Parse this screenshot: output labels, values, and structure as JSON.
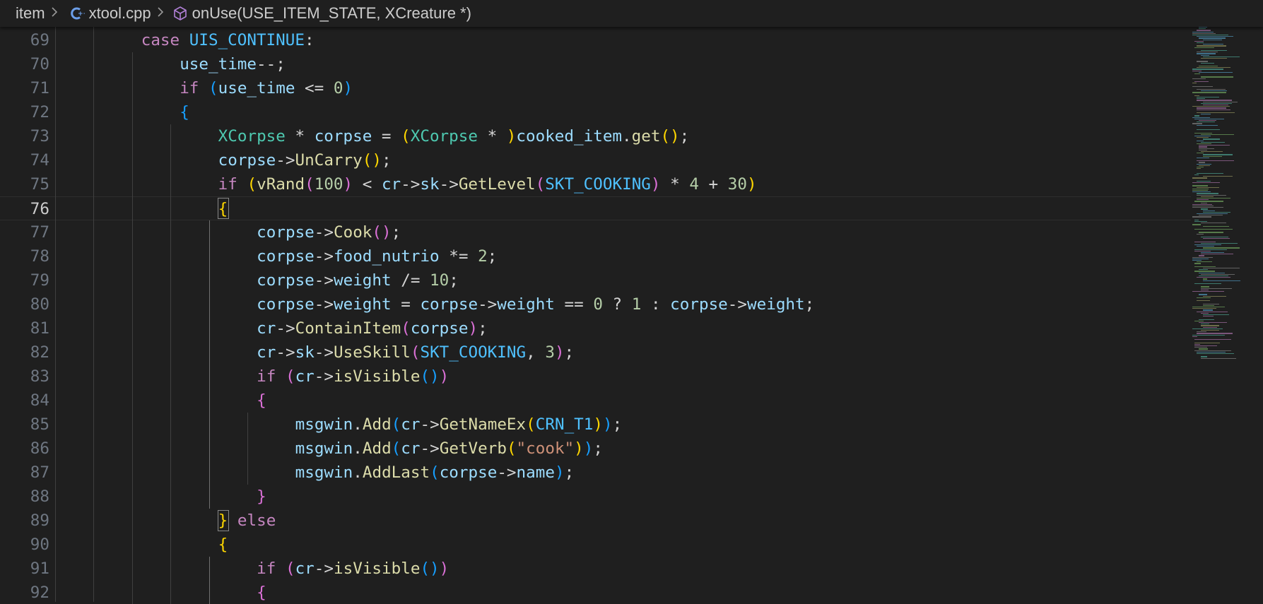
{
  "breadcrumb": {
    "folder": "item",
    "file": "xtool.cpp",
    "symbol": "onUse(USE_ITEM_STATE, XCreature *)",
    "file_icon": "cpp-file-icon",
    "symbol_icon": "method-cube-icon"
  },
  "editor": {
    "current_line": 76,
    "lines": [
      {
        "n": "69",
        "tokens": [
          [
            "case ",
            "kw"
          ],
          [
            "UIS_CONTINUE",
            "en"
          ],
          [
            ":",
            "op"
          ]
        ]
      },
      {
        "n": "70",
        "tokens": [
          [
            "use_time",
            "var"
          ],
          [
            "--;",
            "op"
          ]
        ]
      },
      {
        "n": "71",
        "tokens": [
          [
            "if ",
            "ctl"
          ],
          [
            "(",
            "b3"
          ],
          [
            "use_time",
            "var"
          ],
          [
            " <= ",
            "op"
          ],
          [
            "0",
            "num"
          ],
          [
            ")",
            "b3"
          ]
        ]
      },
      {
        "n": "72",
        "tokens": [
          [
            "{",
            "b3"
          ]
        ]
      },
      {
        "n": "73",
        "tokens": [
          [
            "XCorpse",
            "typ"
          ],
          [
            " * ",
            "op"
          ],
          [
            "corpse",
            "var"
          ],
          [
            " = ",
            "op"
          ],
          [
            "(",
            "b1"
          ],
          [
            "XCorpse",
            "typ"
          ],
          [
            " * ",
            "op"
          ],
          [
            ")",
            "b1"
          ],
          [
            "cooked_item",
            "var"
          ],
          [
            ".",
            "op"
          ],
          [
            "get",
            "fn"
          ],
          [
            "()",
            "b1"
          ],
          [
            ";",
            "op"
          ]
        ]
      },
      {
        "n": "74",
        "tokens": [
          [
            "corpse",
            "var"
          ],
          [
            "->",
            "op"
          ],
          [
            "UnCarry",
            "fn"
          ],
          [
            "()",
            "b1"
          ],
          [
            ";",
            "op"
          ]
        ]
      },
      {
        "n": "75",
        "tokens": [
          [
            "if ",
            "ctl"
          ],
          [
            "(",
            "b1"
          ],
          [
            "vRand",
            "fn"
          ],
          [
            "(",
            "b2"
          ],
          [
            "100",
            "num"
          ],
          [
            ")",
            "b2"
          ],
          [
            " < ",
            "op"
          ],
          [
            "cr",
            "var"
          ],
          [
            "->",
            "op"
          ],
          [
            "sk",
            "var"
          ],
          [
            "->",
            "op"
          ],
          [
            "GetLevel",
            "fn"
          ],
          [
            "(",
            "b2"
          ],
          [
            "SKT_COOKING",
            "en"
          ],
          [
            ")",
            "b2"
          ],
          [
            " * ",
            "op"
          ],
          [
            "4",
            "num"
          ],
          [
            " + ",
            "op"
          ],
          [
            "30",
            "num"
          ],
          [
            ")",
            "b1"
          ]
        ]
      },
      {
        "n": "76",
        "tokens": [
          [
            "{",
            "b1"
          ]
        ]
      },
      {
        "n": "77",
        "tokens": [
          [
            "corpse",
            "var"
          ],
          [
            "->",
            "op"
          ],
          [
            "Cook",
            "fn"
          ],
          [
            "()",
            "b2"
          ],
          [
            ";",
            "op"
          ]
        ]
      },
      {
        "n": "78",
        "tokens": [
          [
            "corpse",
            "var"
          ],
          [
            "->",
            "op"
          ],
          [
            "food_nutrio",
            "var"
          ],
          [
            " *= ",
            "op"
          ],
          [
            "2",
            "num"
          ],
          [
            ";",
            "op"
          ]
        ]
      },
      {
        "n": "79",
        "tokens": [
          [
            "corpse",
            "var"
          ],
          [
            "->",
            "op"
          ],
          [
            "weight",
            "var"
          ],
          [
            " /= ",
            "op"
          ],
          [
            "10",
            "num"
          ],
          [
            ";",
            "op"
          ]
        ]
      },
      {
        "n": "80",
        "tokens": [
          [
            "corpse",
            "var"
          ],
          [
            "->",
            "op"
          ],
          [
            "weight",
            "var"
          ],
          [
            " = ",
            "op"
          ],
          [
            "corpse",
            "var"
          ],
          [
            "->",
            "op"
          ],
          [
            "weight",
            "var"
          ],
          [
            " == ",
            "op"
          ],
          [
            "0",
            "num"
          ],
          [
            " ? ",
            "op"
          ],
          [
            "1",
            "num"
          ],
          [
            " : ",
            "op"
          ],
          [
            "corpse",
            "var"
          ],
          [
            "->",
            "op"
          ],
          [
            "weight",
            "var"
          ],
          [
            ";",
            "op"
          ]
        ]
      },
      {
        "n": "81",
        "tokens": [
          [
            "cr",
            "var"
          ],
          [
            "->",
            "op"
          ],
          [
            "ContainItem",
            "fn"
          ],
          [
            "(",
            "b2"
          ],
          [
            "corpse",
            "var"
          ],
          [
            ")",
            "b2"
          ],
          [
            ";",
            "op"
          ]
        ]
      },
      {
        "n": "82",
        "tokens": [
          [
            "cr",
            "var"
          ],
          [
            "->",
            "op"
          ],
          [
            "sk",
            "var"
          ],
          [
            "->",
            "op"
          ],
          [
            "UseSkill",
            "fn"
          ],
          [
            "(",
            "b2"
          ],
          [
            "SKT_COOKING",
            "en"
          ],
          [
            ", ",
            "op"
          ],
          [
            "3",
            "num"
          ],
          [
            ")",
            "b2"
          ],
          [
            ";",
            "op"
          ]
        ]
      },
      {
        "n": "83",
        "tokens": [
          [
            "if ",
            "ctl"
          ],
          [
            "(",
            "b2"
          ],
          [
            "cr",
            "var"
          ],
          [
            "->",
            "op"
          ],
          [
            "isVisible",
            "fn"
          ],
          [
            "()",
            "b3"
          ],
          [
            ")",
            "b2"
          ]
        ]
      },
      {
        "n": "84",
        "tokens": [
          [
            "{",
            "b2"
          ]
        ]
      },
      {
        "n": "85",
        "tokens": [
          [
            "msgwin",
            "var"
          ],
          [
            ".",
            "op"
          ],
          [
            "Add",
            "fn"
          ],
          [
            "(",
            "b3"
          ],
          [
            "cr",
            "var"
          ],
          [
            "->",
            "op"
          ],
          [
            "GetNameEx",
            "fn"
          ],
          [
            "(",
            "b1"
          ],
          [
            "CRN_T1",
            "en"
          ],
          [
            ")",
            "b1"
          ],
          [
            ")",
            "b3"
          ],
          [
            ";",
            "op"
          ]
        ]
      },
      {
        "n": "86",
        "tokens": [
          [
            "msgwin",
            "var"
          ],
          [
            ".",
            "op"
          ],
          [
            "Add",
            "fn"
          ],
          [
            "(",
            "b3"
          ],
          [
            "cr",
            "var"
          ],
          [
            "->",
            "op"
          ],
          [
            "GetVerb",
            "fn"
          ],
          [
            "(",
            "b1"
          ],
          [
            "\"cook\"",
            "str"
          ],
          [
            ")",
            "b1"
          ],
          [
            ")",
            "b3"
          ],
          [
            ";",
            "op"
          ]
        ]
      },
      {
        "n": "87",
        "tokens": [
          [
            "msgwin",
            "var"
          ],
          [
            ".",
            "op"
          ],
          [
            "AddLast",
            "fn"
          ],
          [
            "(",
            "b3"
          ],
          [
            "corpse",
            "var"
          ],
          [
            "->",
            "op"
          ],
          [
            "name",
            "var"
          ],
          [
            ")",
            "b3"
          ],
          [
            ";",
            "op"
          ]
        ]
      },
      {
        "n": "88",
        "tokens": [
          [
            "}",
            "b2"
          ]
        ]
      },
      {
        "n": "89",
        "tokens": [
          [
            "}",
            "b1"
          ],
          [
            " else",
            "ctl"
          ]
        ]
      },
      {
        "n": "90",
        "tokens": [
          [
            "{",
            "b1"
          ]
        ]
      },
      {
        "n": "91",
        "tokens": [
          [
            "if ",
            "ctl"
          ],
          [
            "(",
            "b2"
          ],
          [
            "cr",
            "var"
          ],
          [
            "->",
            "op"
          ],
          [
            "isVisible",
            "fn"
          ],
          [
            "()",
            "b3"
          ],
          [
            ")",
            "b2"
          ]
        ]
      },
      {
        "n": "92",
        "tokens": [
          [
            "{",
            "b2"
          ]
        ]
      }
    ]
  }
}
